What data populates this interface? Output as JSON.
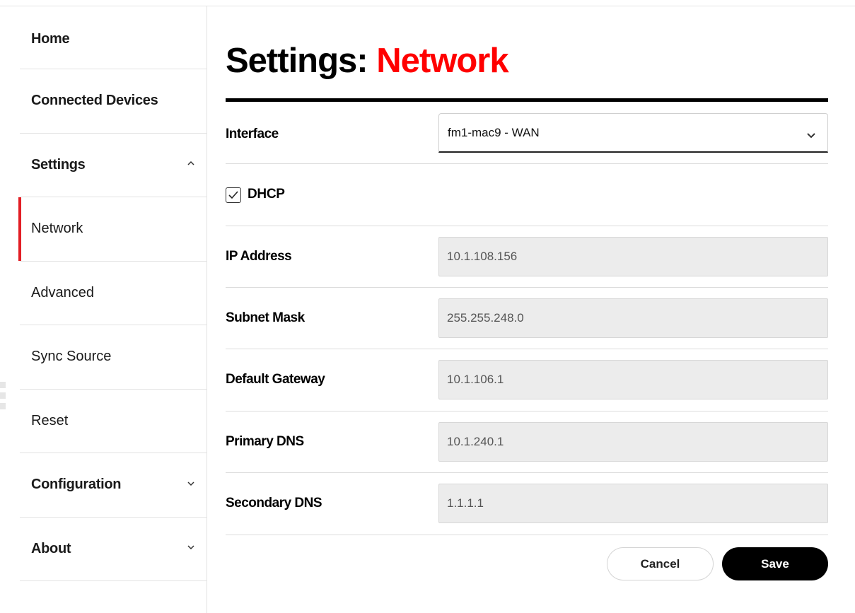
{
  "sidebar": {
    "items": [
      {
        "label": "Home"
      },
      {
        "label": "Connected Devices"
      },
      {
        "label": "Settings"
      },
      {
        "label": "Network"
      },
      {
        "label": "Advanced"
      },
      {
        "label": "Sync Source"
      },
      {
        "label": "Reset"
      },
      {
        "label": "Configuration"
      },
      {
        "label": "About"
      }
    ],
    "active_accent": "#e21e25"
  },
  "page": {
    "title_prefix": "Settings:",
    "title_accent": "Network",
    "accent_color": "#ff0000"
  },
  "form": {
    "interface": {
      "label": "Interface",
      "value": "fm1-mac9 - WAN"
    },
    "dhcp": {
      "label": "DHCP",
      "checked": true
    },
    "ip_address": {
      "label": "IP Address",
      "value": "10.1.108.156"
    },
    "subnet_mask": {
      "label": "Subnet Mask",
      "value": "255.255.248.0"
    },
    "default_gateway": {
      "label": "Default Gateway",
      "value": "10.1.106.1"
    },
    "primary_dns": {
      "label": "Primary DNS",
      "value": "10.1.240.1"
    },
    "secondary_dns": {
      "label": "Secondary DNS",
      "value": "1.1.1.1"
    }
  },
  "actions": {
    "cancel_label": "Cancel",
    "save_label": "Save"
  }
}
